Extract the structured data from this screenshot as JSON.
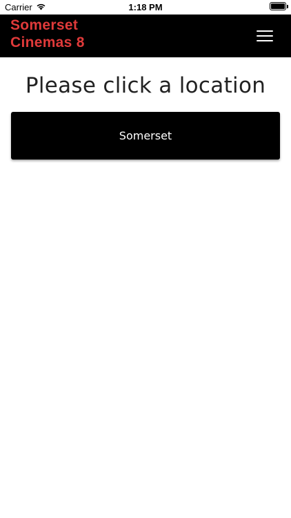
{
  "status_bar": {
    "carrier": "Carrier",
    "time": "1:18 PM",
    "wifi_icon": "wifi-icon",
    "battery_icon": "battery-icon"
  },
  "header": {
    "brand_line1": "Somerset",
    "brand_line2": "Cinemas 8",
    "brand_color": "#e03a3a",
    "background_color": "#000000",
    "menu_icon": "hamburger-menu-icon"
  },
  "main": {
    "title": "Please click a location",
    "locations": [
      {
        "label": "Somerset"
      }
    ]
  }
}
